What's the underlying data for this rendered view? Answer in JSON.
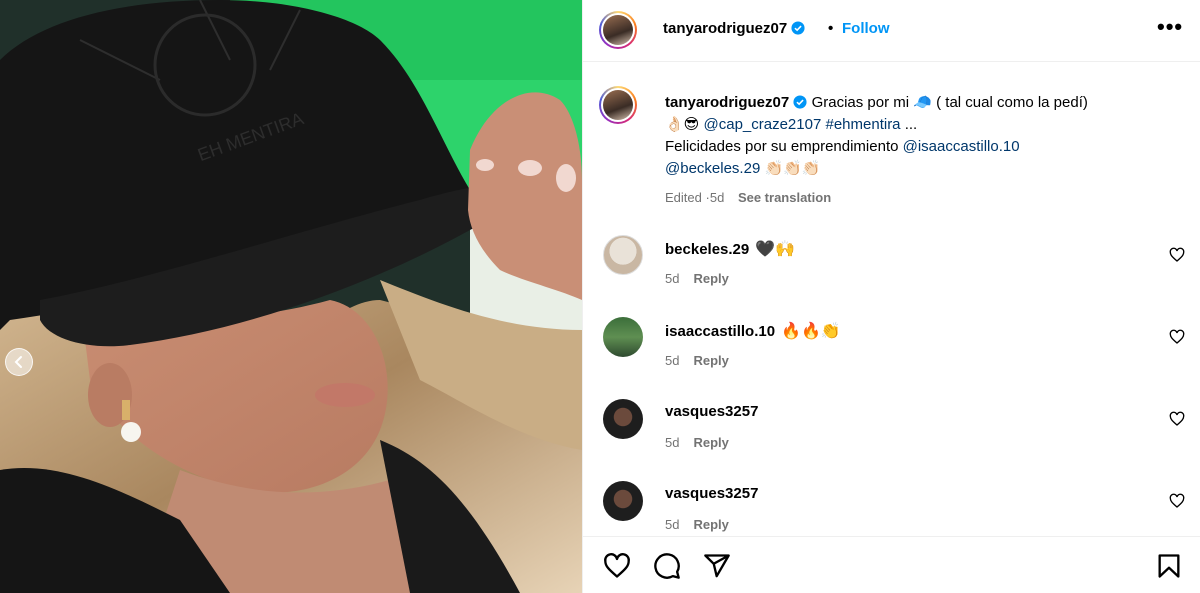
{
  "post": {
    "username": "tanyarodriguez07",
    "verified": true,
    "separator": "•",
    "follow_label": "Follow",
    "more_icon": "more-horizontal-icon"
  },
  "caption": {
    "username": "tanyarodriguez07",
    "line1_text": "Gracias por mi",
    "cap_emoji": "🧢",
    "line1_rest": "( tal cual como la pedí)",
    "emojis_a": "👌🏻😎",
    "mention_cap": "@cap_craze2107",
    "hashtag": "#ehmentira",
    "ellipsis": "...",
    "line3_text": "Felicidades por su emprendimiento",
    "mention_isaac": "@isaaccastillo.10",
    "mention_beck": "@beckeles.29",
    "emojis_b": "👏🏻👏🏻👏🏻",
    "edited": "Edited",
    "meta_sep": "·",
    "age": "5d",
    "see_translation": "See translation"
  },
  "comments": [
    {
      "username": "beckeles.29",
      "text": "🖤🙌",
      "age": "5d",
      "reply": "Reply"
    },
    {
      "username": "isaaccastillo.10",
      "text": "🔥🔥👏",
      "age": "5d",
      "reply": "Reply"
    },
    {
      "username": "vasques3257",
      "text": "",
      "age": "5d",
      "reply": "Reply"
    },
    {
      "username": "vasques3257",
      "text": "",
      "age": "5d",
      "reply": "Reply"
    }
  ],
  "cap_print": {
    "line1": "EH MENTIRA"
  },
  "colors": {
    "accent": "#0095f6",
    "link": "#00376b",
    "muted": "#737373"
  }
}
